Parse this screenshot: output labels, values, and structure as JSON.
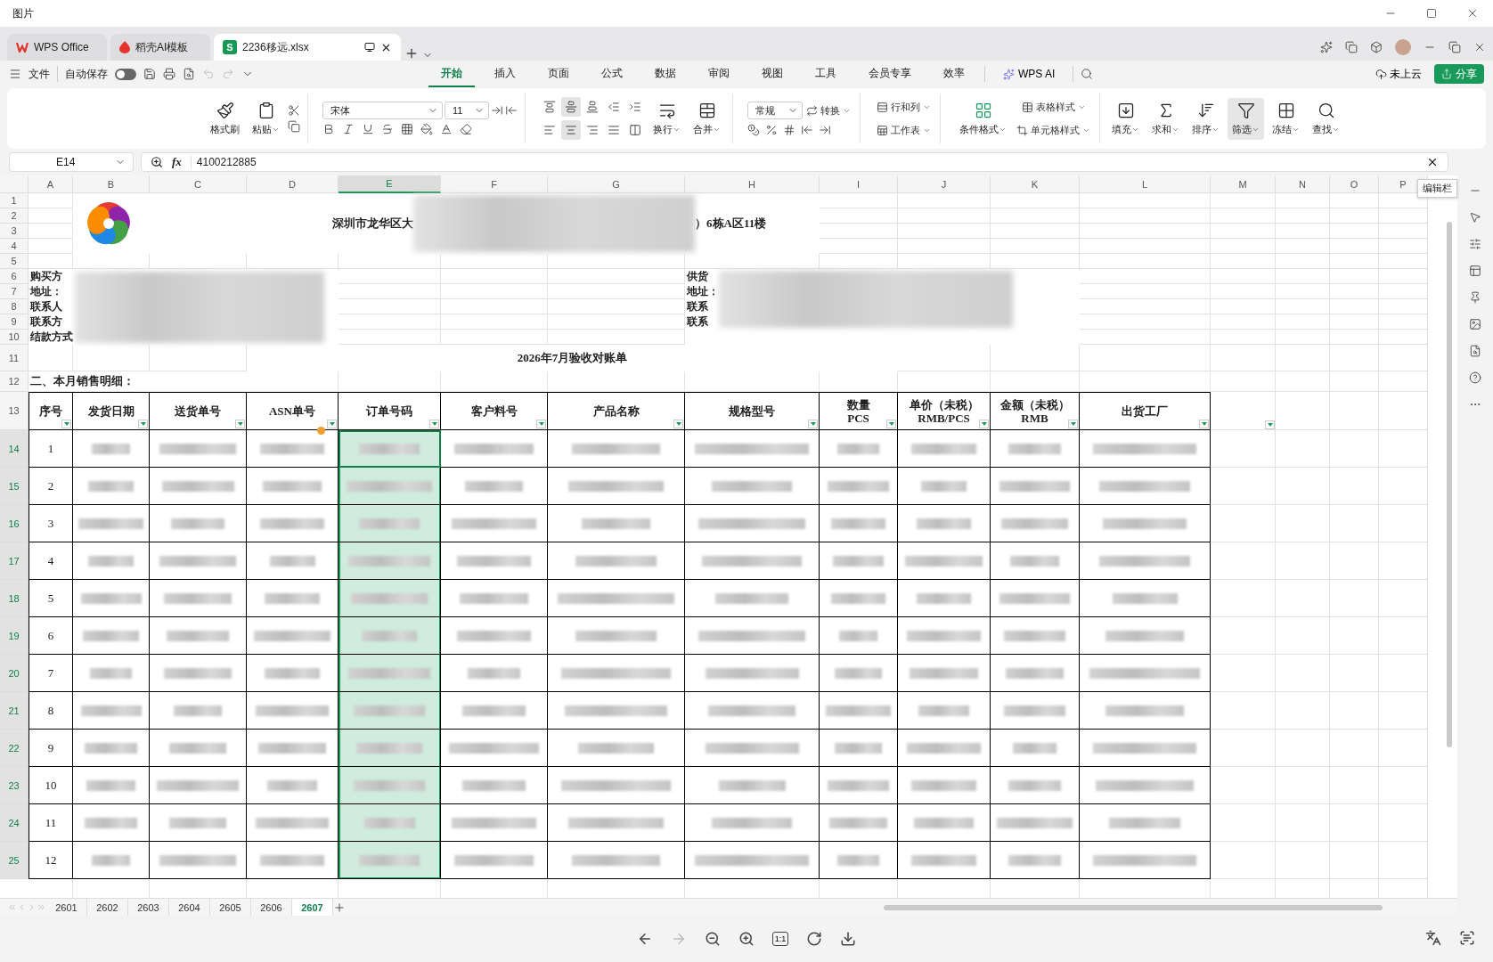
{
  "window": {
    "title": "图片"
  },
  "doc_tabs": [
    {
      "label": "WPS Office",
      "kind": "home",
      "selected": false
    },
    {
      "label": "稻壳AI模板",
      "kind": "template",
      "selected": false
    },
    {
      "label": "2236移远.xlsx",
      "kind": "sheet",
      "icon_letter": "S",
      "selected": true
    }
  ],
  "menu_bar": {
    "file": "文件",
    "autosave": "自动保存",
    "autosave_on": false
  },
  "ribbon_tabs": [
    {
      "label": "开始",
      "selected": true
    },
    {
      "label": "插入",
      "selected": false
    },
    {
      "label": "页面",
      "selected": false
    },
    {
      "label": "公式",
      "selected": false
    },
    {
      "label": "数据",
      "selected": false
    },
    {
      "label": "审阅",
      "selected": false
    },
    {
      "label": "视图",
      "selected": false
    },
    {
      "label": "工具",
      "selected": false
    },
    {
      "label": "会员专享",
      "selected": false
    },
    {
      "label": "效率",
      "selected": false
    }
  ],
  "ai_tab": "WPS AI",
  "cloud_status": "未上云",
  "share": "分享",
  "ribbon": {
    "format_painter": "格式刷",
    "paste": "粘贴",
    "font_name": "宋体",
    "font_size": "11",
    "vertical_align": [
      {
        "selected": false
      },
      {
        "selected": true
      },
      {
        "selected": false
      }
    ],
    "horizontal_align": [
      {
        "selected": false
      },
      {
        "selected": true
      },
      {
        "selected": false
      },
      {
        "selected": false
      },
      {
        "selected": false
      }
    ],
    "wrap": "换行",
    "merge": "合并",
    "number_format": "常规",
    "convert": "转换",
    "rows_cols": "行和列",
    "worksheet": "工作表",
    "conditional": "条件格式",
    "table_style": "表格样式",
    "cell_style": "单元格样式",
    "tools": [
      {
        "label": "填充",
        "selected": false
      },
      {
        "label": "求和",
        "selected": false
      },
      {
        "label": "排序",
        "selected": false
      },
      {
        "label": "筛选",
        "selected": true
      },
      {
        "label": "冻结",
        "selected": false
      },
      {
        "label": "查找",
        "selected": false
      }
    ]
  },
  "formula_bar": {
    "fx_label": "fx",
    "cell": "E14",
    "value": "4100212885",
    "tooltip": "编辑栏"
  },
  "sheet": {
    "columns": [
      {
        "label": "A",
        "selected": false
      },
      {
        "label": "B",
        "selected": false
      },
      {
        "label": "C",
        "selected": false
      },
      {
        "label": "D",
        "selected": false
      },
      {
        "label": "E",
        "selected": true
      },
      {
        "label": "F",
        "selected": false
      },
      {
        "label": "G",
        "selected": false
      },
      {
        "label": "H",
        "selected": false
      },
      {
        "label": "I",
        "selected": false
      },
      {
        "label": "J",
        "selected": false
      },
      {
        "label": "K",
        "selected": false
      },
      {
        "label": "L",
        "selected": false
      },
      {
        "label": "M",
        "selected": false
      },
      {
        "label": "N",
        "selected": false
      },
      {
        "label": "O",
        "selected": false
      },
      {
        "label": "P",
        "selected": false
      }
    ],
    "rows": [
      {
        "label": "1",
        "selected": false
      },
      {
        "label": "2",
        "selected": false
      },
      {
        "label": "3",
        "selected": false
      },
      {
        "label": "4",
        "selected": false
      },
      {
        "label": "5",
        "selected": false
      },
      {
        "label": "6",
        "selected": false
      },
      {
        "label": "7",
        "selected": false
      },
      {
        "label": "8",
        "selected": false
      },
      {
        "label": "9",
        "selected": false
      },
      {
        "label": "10",
        "selected": false
      },
      {
        "label": "11",
        "selected": false
      },
      {
        "label": "12",
        "selected": false
      },
      {
        "label": "13",
        "selected": false
      },
      {
        "label": "14",
        "selected": true
      },
      {
        "label": "15",
        "selected": true
      },
      {
        "label": "16",
        "selected": true
      },
      {
        "label": "17",
        "selected": true
      },
      {
        "label": "18",
        "selected": true
      },
      {
        "label": "19",
        "selected": true
      },
      {
        "label": "20",
        "selected": true
      },
      {
        "label": "21",
        "selected": true
      },
      {
        "label": "22",
        "selected": true
      },
      {
        "label": "23",
        "selected": true
      },
      {
        "label": "24",
        "selected": true
      },
      {
        "label": "25",
        "selected": true
      }
    ],
    "address_left": "深圳市龙华区大",
    "address_right": "）6栋A区11楼",
    "buyer_labels": [
      "购买方",
      "地址：",
      "联系人",
      "联系方",
      "结款方式"
    ],
    "supplier_labels": [
      "供货",
      "地址：",
      "联系",
      "联系"
    ],
    "statement_title": "2026年7月验收对账单",
    "section_title": "二、本月销售明细：",
    "headers": [
      {
        "lines": [
          "序号"
        ]
      },
      {
        "lines": [
          "发货日期"
        ]
      },
      {
        "lines": [
          "送货单号"
        ]
      },
      {
        "lines": [
          "ASN单号"
        ]
      },
      {
        "lines": [
          "订单号码"
        ]
      },
      {
        "lines": [
          "客户料号"
        ]
      },
      {
        "lines": [
          "产品名称"
        ]
      },
      {
        "lines": [
          "规格型号"
        ]
      },
      {
        "lines": [
          "数量",
          "PCS"
        ]
      },
      {
        "lines": [
          "单价（未税）",
          "RMB/PCS"
        ]
      },
      {
        "lines": [
          "金额（未税）",
          "RMB"
        ]
      },
      {
        "lines": [
          "出货工厂"
        ]
      }
    ],
    "row_numbers": [
      "1",
      "2",
      "3",
      "4",
      "5",
      "6",
      "7",
      "8",
      "9",
      "10",
      "11",
      "12"
    ]
  },
  "sheet_tabs": [
    {
      "label": "2601",
      "selected": false
    },
    {
      "label": "2602",
      "selected": false
    },
    {
      "label": "2603",
      "selected": false
    },
    {
      "label": "2604",
      "selected": false
    },
    {
      "label": "2605",
      "selected": false
    },
    {
      "label": "2606",
      "selected": false
    },
    {
      "label": "2607",
      "selected": true
    }
  ],
  "viewer": {
    "actual_size": "1:1"
  }
}
